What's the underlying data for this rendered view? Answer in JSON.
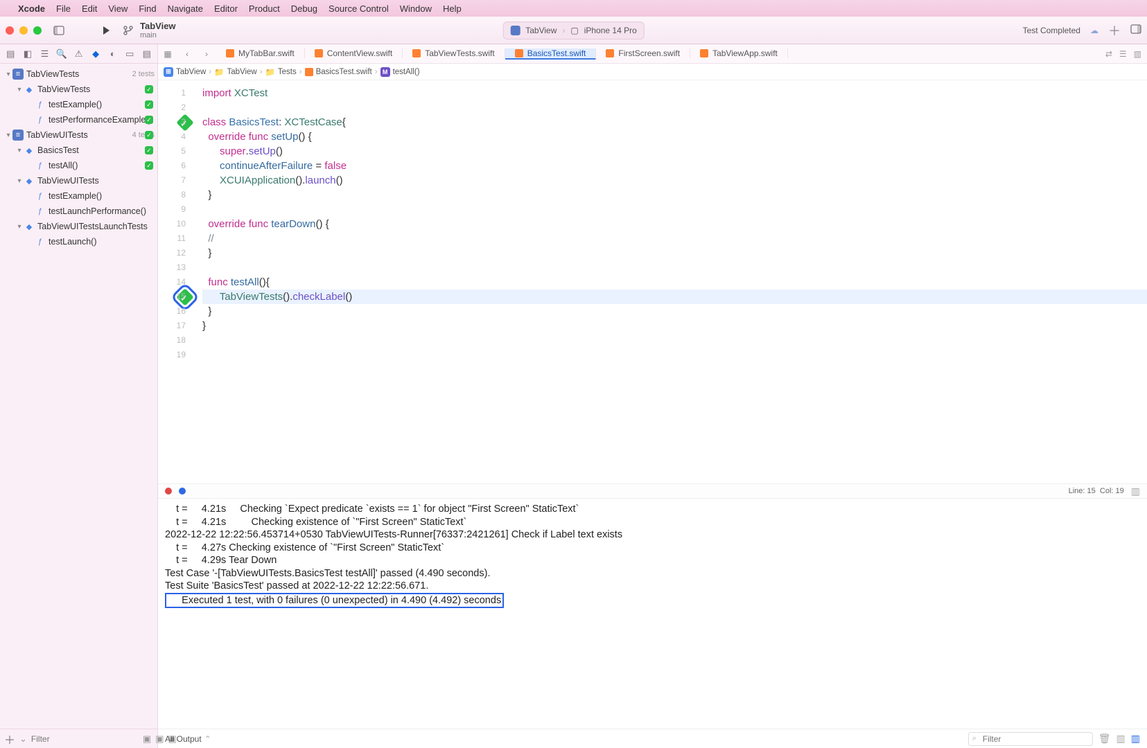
{
  "menu": {
    "apple": "",
    "app": "Xcode",
    "items": [
      "File",
      "Edit",
      "View",
      "Find",
      "Navigate",
      "Editor",
      "Product",
      "Debug",
      "Source Control",
      "Window",
      "Help"
    ]
  },
  "titlebar": {
    "scheme_name": "TabView",
    "scheme_branch": "main",
    "target": "TabView",
    "device": "iPhone 14 Pro",
    "status_text": "Test Completed"
  },
  "navigator": {
    "groups": [
      {
        "name": "TabViewTests",
        "count": "2 tests",
        "kind": "bundle",
        "children": [
          {
            "name": "TabViewTests",
            "kind": "class",
            "status": true,
            "children": [
              {
                "name": "testExample()",
                "kind": "test",
                "status": true
              },
              {
                "name": "testPerformanceExample()",
                "kind": "test",
                "status": true
              }
            ]
          }
        ]
      },
      {
        "name": "TabViewUITests",
        "count": "4 tests",
        "kind": "bundle",
        "status": true,
        "children": [
          {
            "name": "BasicsTest",
            "kind": "class",
            "status": true,
            "children": [
              {
                "name": "testAll()",
                "kind": "test",
                "status": true
              }
            ]
          },
          {
            "name": "TabViewUITests",
            "kind": "class",
            "children": [
              {
                "name": "testExample()",
                "kind": "test"
              },
              {
                "name": "testLaunchPerformance()",
                "kind": "test"
              }
            ]
          },
          {
            "name": "TabViewUITestsLaunchTests",
            "kind": "class",
            "children": [
              {
                "name": "testLaunch()",
                "kind": "test"
              }
            ]
          }
        ]
      }
    ],
    "filter_placeholder": "Filter"
  },
  "tabs": [
    {
      "label": "MyTabBar.swift"
    },
    {
      "label": "ContentView.swift"
    },
    {
      "label": "TabViewTests.swift"
    },
    {
      "label": "BasicsTest.swift",
      "selected": true
    },
    {
      "label": "FirstScreen.swift"
    },
    {
      "label": "TabViewApp.swift"
    }
  ],
  "jumpbar": [
    "TabView",
    "TabView",
    "Tests",
    "BasicsTest.swift",
    "testAll()"
  ],
  "cursor": {
    "line": 15,
    "col": 19
  },
  "console": {
    "selector": "All Output",
    "filter_placeholder": "Filter",
    "lines": [
      "    t =     4.21s     Checking `Expect predicate `exists == 1` for object \"First Screen\" StaticText`",
      "    t =     4.21s         Checking existence of `\"First Screen\" StaticText`",
      "2022-12-22 12:22:56.453714+0530 TabViewUITests-Runner[76337:2421261] Check if Label text exists",
      "    t =     4.27s Checking existence of `\"First Screen\" StaticText`",
      "    t =     4.29s Tear Down",
      "Test Case '-[TabViewUITests.BasicsTest testAll]' passed (4.490 seconds).",
      "Test Suite 'BasicsTest' passed at 2022-12-22 12:22:56.671."
    ],
    "summary": "     Executed 1 test, with 0 failures (0 unexpected) in 4.490 (4.492) seconds"
  },
  "code": {
    "lines": [
      {
        "n": 1,
        "html": "<span class='kw'>import</span> <span class='typ'>XCTest</span>"
      },
      {
        "n": 2,
        "html": ""
      },
      {
        "n": 3,
        "html": "<span class='kw'>class</span> <span class='cls'>BasicsTest</span>: <span class='typ'>XCTestCase</span>{",
        "diamond": true
      },
      {
        "n": 4,
        "html": "  <span class='kw'>override</span> <span class='kw'>func</span> <span class='fn'>setUp</span>() {"
      },
      {
        "n": 5,
        "html": "      <span class='kw'>super</span>.<span class='call'>setUp</span>()"
      },
      {
        "n": 6,
        "html": "      <span class='fn'>continueAfterFailure</span> = <span class='kw'>false</span>"
      },
      {
        "n": 7,
        "html": "      <span class='typ'>XCUIApplication</span>().<span class='call'>launch</span>()"
      },
      {
        "n": 8,
        "html": "  }"
      },
      {
        "n": 9,
        "html": ""
      },
      {
        "n": 10,
        "html": "  <span class='kw'>override</span> <span class='kw'>func</span> <span class='fn'>tearDown</span>() {"
      },
      {
        "n": 11,
        "html": "  <span class='cmt'>//</span>"
      },
      {
        "n": 12,
        "html": "  }"
      },
      {
        "n": 13,
        "html": ""
      },
      {
        "n": 14,
        "html": "  <span class='kw'>func</span> <span class='fn'>testAll</span>(){",
        "diamond": true
      },
      {
        "n": 15,
        "html": "      <span class='typ'>TabViewTests</span>().<span class='call'>checkLabel</span>()",
        "hl": true
      },
      {
        "n": 16,
        "html": "  }"
      },
      {
        "n": 17,
        "html": "}"
      },
      {
        "n": 18,
        "html": ""
      },
      {
        "n": 19,
        "html": ""
      }
    ]
  }
}
